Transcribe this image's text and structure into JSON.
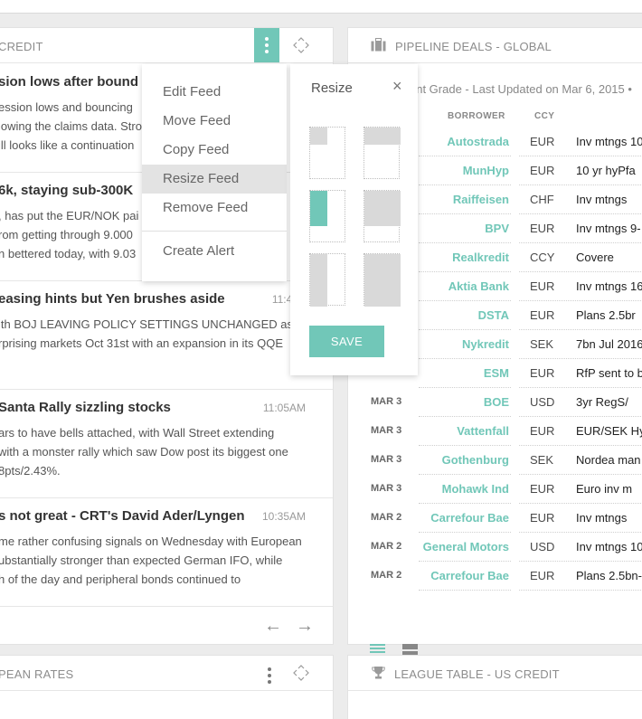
{
  "credit_panel": {
    "title": "CREDIT",
    "news": [
      {
        "headline": "sion lows after bound at",
        "time": "",
        "text": [
          "ession lows and bouncing",
          "lowing the claims data. Stro",
          "ill looks like a continuation"
        ]
      },
      {
        "headline": "6k, staying sub-300K",
        "time": "",
        "text": [
          ", has put the EUR/NOK pai",
          "rom getting through 9.000",
          "n bettered today, with 9.03"
        ]
      },
      {
        "headline": "easing hints but Yen brushes aside",
        "time": "11:48A",
        "text": [
          "ith BOJ LEAVING POLICY SETTINGS UNCHANGED as",
          "rprising markets Oct 31st with an expansion in its QQE"
        ]
      },
      {
        "headline": "Santa Rally sizzling stocks",
        "time": "11:05AM",
        "text": [
          "ars to have bells attached, with Wall Street extending",
          "with a monster rally which saw Dow post its biggest one",
          "8pts/2.43%."
        ]
      },
      {
        "headline": "s not great - CRT's David Ader/Lyngen",
        "time": "10:35AM",
        "text": [
          "me rather confusing signals on Wednesday with European",
          "ubstantially stronger than expected German IFO, while",
          "h of the day and peripheral bonds continued to"
        ]
      }
    ],
    "footer": {
      "prev": "←",
      "next": "→"
    }
  },
  "context_menu": {
    "items": [
      "Edit Feed",
      "Move Feed",
      "Copy Feed",
      "Resize Feed",
      "Remove Feed"
    ],
    "hover_index": 3,
    "alert": "Create Alert"
  },
  "resize_popover": {
    "title": "Resize",
    "close": "×",
    "save": "SAVE",
    "selected_option": 2
  },
  "pipeline_panel": {
    "title": "PIPELINE DEALS - GLOBAL",
    "subtitle": "ent Grade - Last Updated on Mar 6, 2015 •",
    "columns": {
      "borrower": "BORROWER",
      "ccy": "CCY"
    },
    "rows": [
      {
        "date": "",
        "borrower": "Autostrada",
        "ccy": "EUR",
        "terms": "Inv mtngs 10"
      },
      {
        "date": "",
        "borrower": "MunHyp",
        "ccy": "EUR",
        "terms": "10 yr hyPfa"
      },
      {
        "date": "",
        "borrower": "Raiffeisen",
        "ccy": "CHF",
        "terms": "Inv mtngs"
      },
      {
        "date": "",
        "borrower": "BPV",
        "ccy": "EUR",
        "terms": "Inv mtngs 9-"
      },
      {
        "date": "",
        "borrower": "Realkredit",
        "ccy": "CCY",
        "terms": "Covere"
      },
      {
        "date": "",
        "borrower": "Aktia Bank",
        "ccy": "EUR",
        "terms": "Inv mtngs 16-"
      },
      {
        "date": "",
        "borrower": "DSTA",
        "ccy": "EUR",
        "terms": "Plans 2.5br"
      },
      {
        "date": "",
        "borrower": "Nykredit",
        "ccy": "SEK",
        "terms": "7bn Jul 2016 c"
      },
      {
        "date": "",
        "borrower": "ESM",
        "ccy": "EUR",
        "terms": "RfP sent to b"
      },
      {
        "date": "MAR 3",
        "borrower": "BOE",
        "ccy": "USD",
        "terms": "3yr RegS/"
      },
      {
        "date": "MAR 3",
        "borrower": "Vattenfall",
        "ccy": "EUR",
        "terms": "EUR/SEK Hyb"
      },
      {
        "date": "MAR 3",
        "borrower": "Gothenburg",
        "ccy": "SEK",
        "terms": "Nordea man"
      },
      {
        "date": "MAR 3",
        "borrower": "Mohawk Ind",
        "ccy": "EUR",
        "terms": "Euro inv m"
      },
      {
        "date": "MAR 2",
        "borrower": "Carrefour Bae",
        "ccy": "EUR",
        "terms": "Inv mtngs"
      },
      {
        "date": "MAR 2",
        "borrower": "General Motors",
        "ccy": "USD",
        "terms": "Inv mtngs 10"
      },
      {
        "date": "MAR 2",
        "borrower": "Carrefour Bae",
        "ccy": "EUR",
        "terms": "Plans 2.5bn-"
      }
    ]
  },
  "europe_panel": {
    "title": "PEAN RATES"
  },
  "league_panel": {
    "title": "LEAGUE TABLE - US CREDIT"
  },
  "colors": {
    "accent": "#71c7b8",
    "hover": "#e3e3e3",
    "option": "#d9d9d9"
  },
  "icons": {
    "more": "more-vertical-icon",
    "move": "move-arrows-icon",
    "briefcase": "briefcase-icon",
    "trophy": "trophy-icon",
    "list": "list-view-icon",
    "grid": "compact-view-icon"
  }
}
